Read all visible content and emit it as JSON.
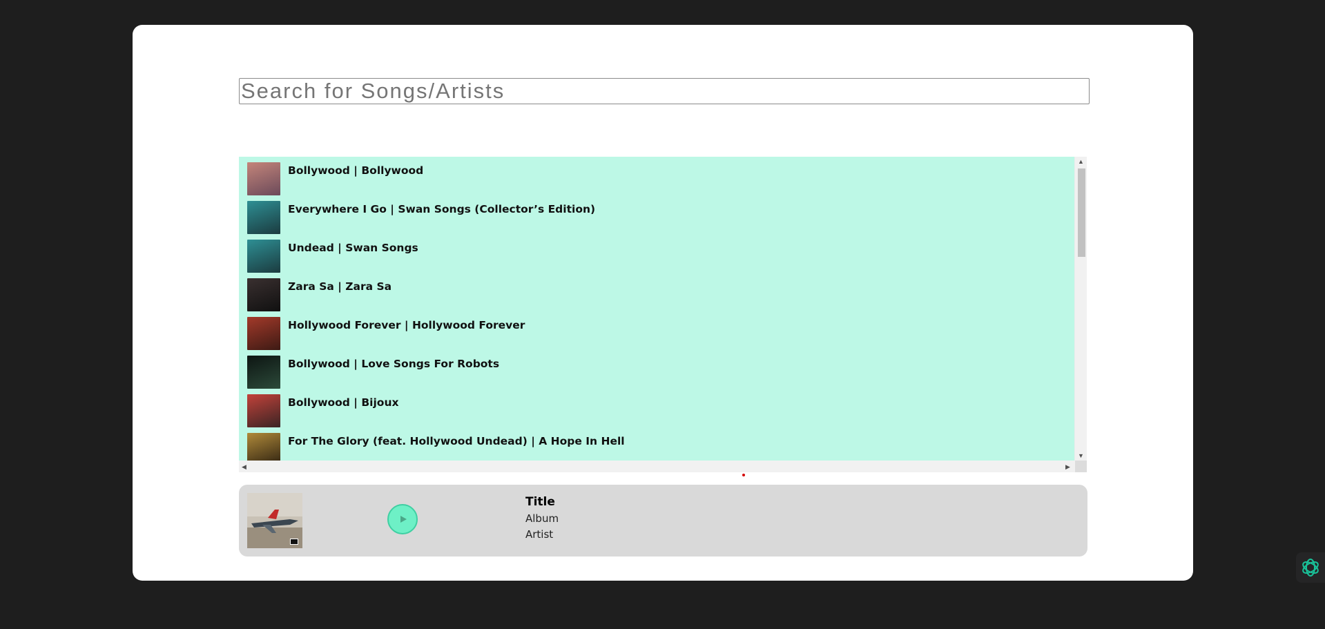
{
  "search": {
    "placeholder": "Search for Songs/Artists",
    "value": ""
  },
  "songs": [
    {
      "label": "Bollywood | Bollywood",
      "art_colors": [
        "#c4857a",
        "#6b4a5a"
      ]
    },
    {
      "label": "Everywhere I Go | Swan Songs (Collector’s Edition)",
      "art_colors": [
        "#2e8f94",
        "#1b3b3f"
      ]
    },
    {
      "label": "Undead | Swan Songs",
      "art_colors": [
        "#2e8f94",
        "#1b3b3f"
      ]
    },
    {
      "label": "Zara Sa | Zara Sa",
      "art_colors": [
        "#3a3030",
        "#101010"
      ]
    },
    {
      "label": "Hollywood Forever | Hollywood Forever",
      "art_colors": [
        "#a33a2a",
        "#3d1a14"
      ]
    },
    {
      "label": "Bollywood | Love Songs For Robots",
      "art_colors": [
        "#0d1512",
        "#2c4a3a"
      ]
    },
    {
      "label": "Bollywood | Bijoux",
      "art_colors": [
        "#c2423a",
        "#3a2424"
      ]
    },
    {
      "label": "For The Glory (feat. Hollywood Undead) | A Hope In Hell",
      "art_colors": [
        "#b08a3a",
        "#2c2010"
      ]
    }
  ],
  "player": {
    "title": "Title",
    "album": "Album",
    "artist": "Artist",
    "play_icon": "play-icon"
  },
  "colors": {
    "list_bg": "#bdf8e6",
    "play_button": "#6ef0c6",
    "player_bg": "#d9d9d9",
    "page_bg": "#1e1e1e"
  }
}
